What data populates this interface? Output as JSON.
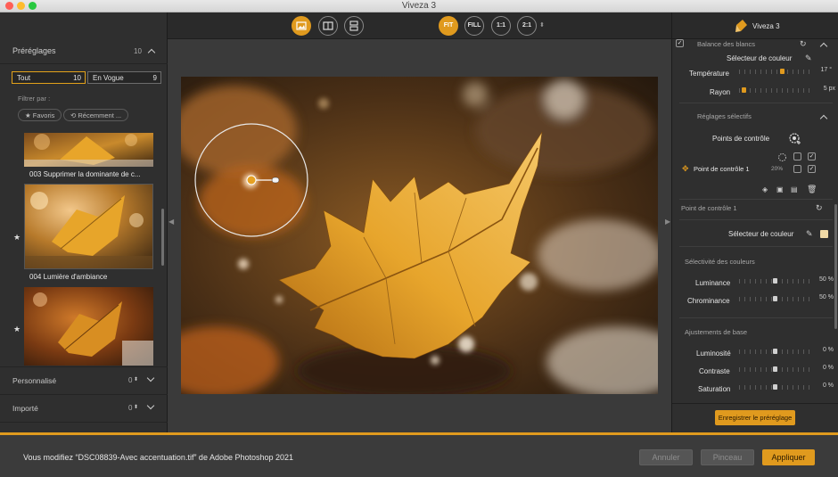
{
  "window": {
    "title": "Viveza 3"
  },
  "left": {
    "presets_label": "Préréglages",
    "presets_count": "10",
    "tabs": [
      {
        "label": "Tout",
        "count": "10"
      },
      {
        "label": "En Vogue",
        "count": "9"
      }
    ],
    "filter_label": "Filtrer par :",
    "filters": [
      "★ Favoris",
      "⟲ Récemment ..."
    ],
    "thumbnails": [
      {
        "label": "003 Supprimer la dominante de c..."
      },
      {
        "label": "004 Lumière d'ambiance"
      },
      {
        "label": ""
      }
    ],
    "sections": [
      {
        "label": "Personnalisé",
        "count": "0"
      },
      {
        "label": "Importé",
        "count": "0"
      }
    ]
  },
  "toolbar": {
    "view_buttons": [
      "FIT",
      "FILL",
      "1:1",
      "2:1"
    ]
  },
  "right": {
    "app_label": "Viveza 3",
    "white_balance": "Balance des blancs",
    "color_picker": "Sélecteur de couleur",
    "temperature_label": "Température",
    "temperature_value": "17 °",
    "radius_label": "Rayon",
    "radius_value": "5 px",
    "selective_label": "Réglages sélectifs",
    "control_points_label": "Points de contrôle",
    "control_point_1": "Point de contrôle 1",
    "control_point_1_pct": "20%",
    "cp_detail_label": "Point de contrôle 1",
    "cp_color_picker": "Sélecteur de couleur",
    "color_selectivity": "Sélectivité des couleurs",
    "luminance_label": "Luminance",
    "luminance_value": "50 %",
    "chrominance_label": "Chrominance",
    "chrominance_value": "50 %",
    "basic_label": "Ajustements de base",
    "brightness_label": "Luminosité",
    "brightness_value": "0 %",
    "contrast_label": "Contraste",
    "contrast_value": "0 %",
    "saturation_label": "Saturation",
    "saturation_value": "0 %",
    "save_preset": "Enregistrer le préréglage"
  },
  "bottom": {
    "message": "Vous modifiez “DSC08839-Avec accentuation.tif” de Adobe Photoshop 2021",
    "cancel": "Annuler",
    "brush": "Pinceau",
    "apply": "Appliquer"
  }
}
